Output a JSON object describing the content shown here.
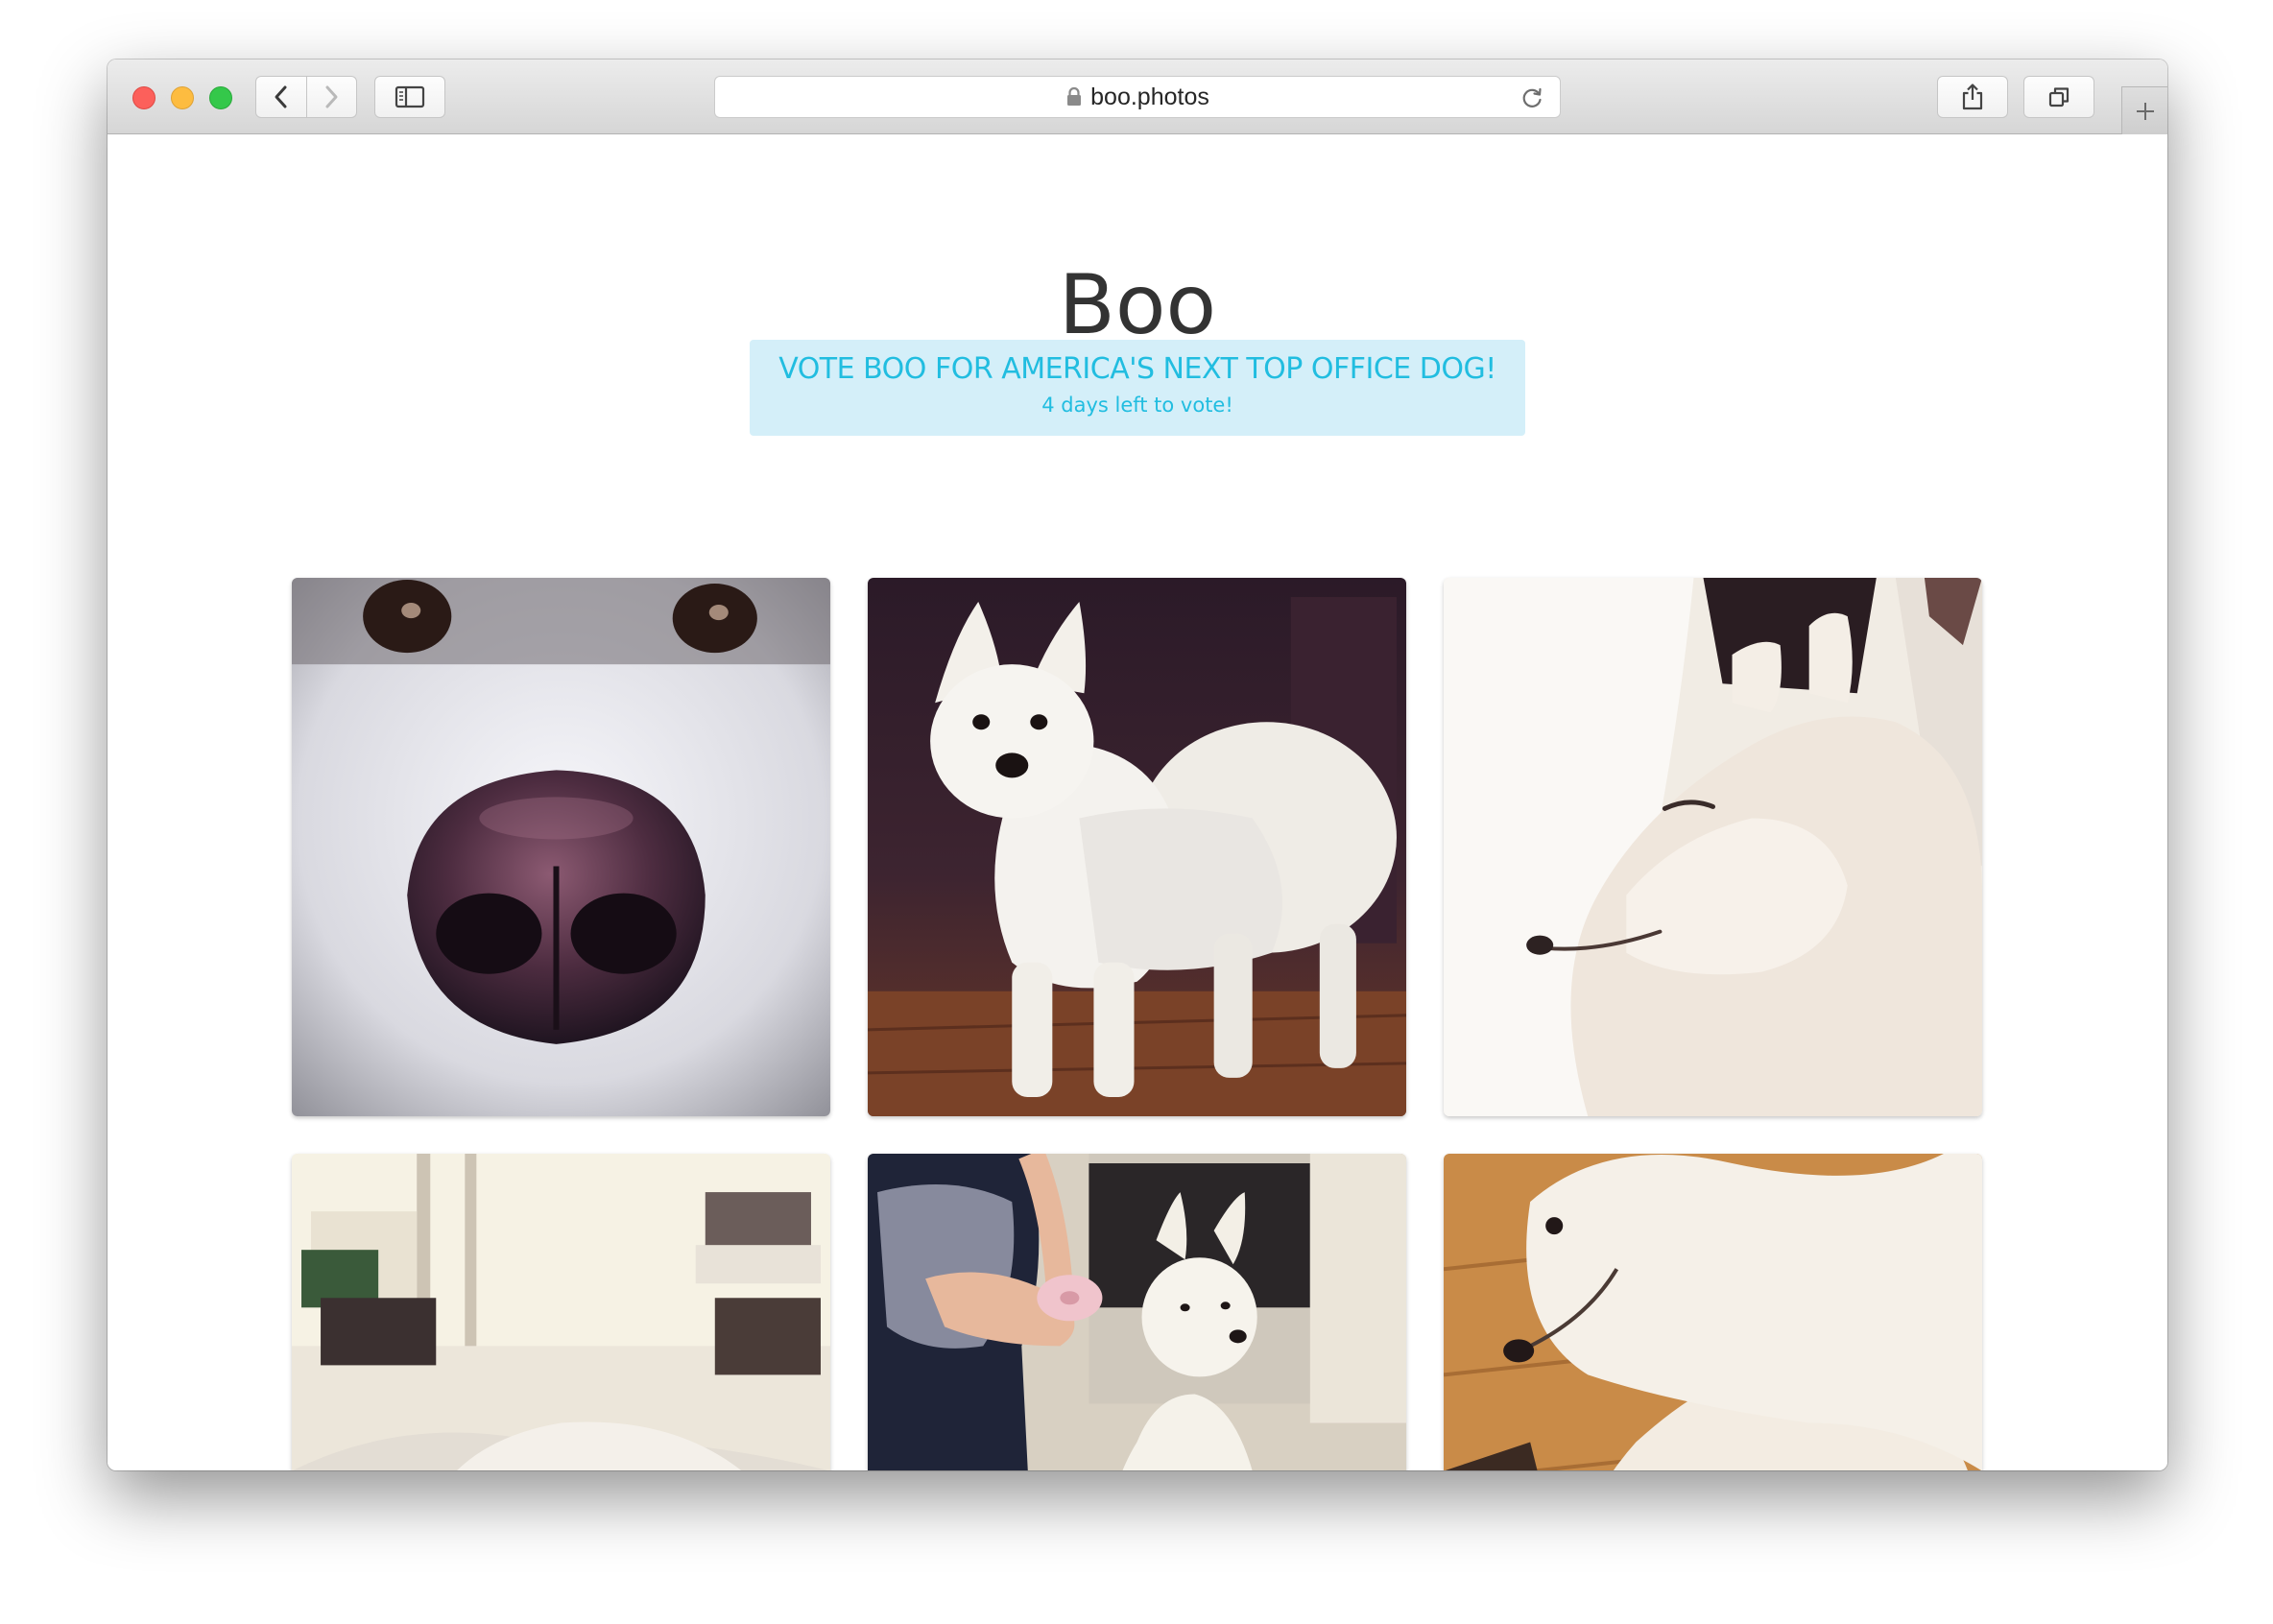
{
  "browser": {
    "url": "boo.photos",
    "icons": {
      "back": "chevron-left-icon",
      "forward": "chevron-right-icon",
      "sidebar": "sidebar-icon",
      "lock": "lock-icon",
      "reload": "reload-icon",
      "share": "share-icon",
      "tabs": "tabs-overview-icon",
      "new_tab": "plus-icon"
    }
  },
  "page": {
    "title": "Boo",
    "vote": {
      "headline": "VOTE BOO FOR AMERICA'S NEXT TOP OFFICE DOG!",
      "subtext": "4 days left to vote!"
    }
  },
  "colors": {
    "vote_text": "#21bde0",
    "vote_background": "#d4eff9",
    "title_text": "#333333"
  }
}
